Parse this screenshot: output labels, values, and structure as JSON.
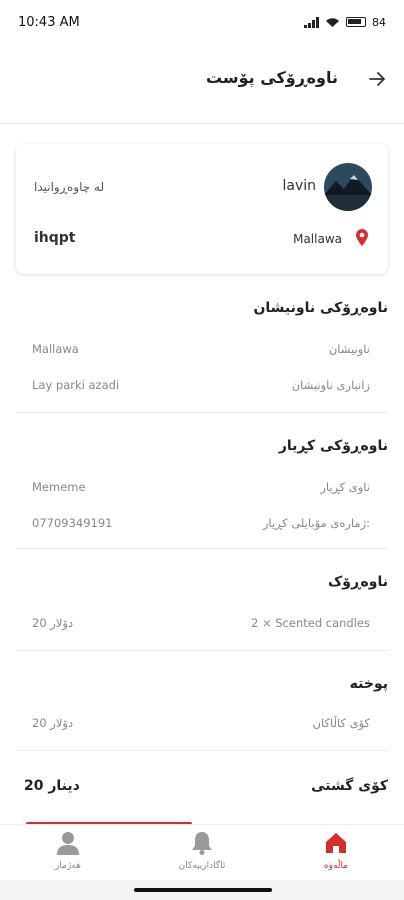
{
  "status": {
    "time": "10:43 AM",
    "battery": "84"
  },
  "header": {
    "title": "ناوەڕۆکی پۆست"
  },
  "order_card": {
    "name": "lavin",
    "waiting_label": "لە چاوەڕوانیدا",
    "order_code": "ihqpt",
    "location": "Mallawa"
  },
  "address_section": {
    "title": "ناوەڕۆکی ناونیشان",
    "rows": [
      {
        "label": "ناونیشان",
        "value": "Mallawa"
      },
      {
        "label": "زانیاری ناونیشان",
        "value": "Lay parki azadi"
      }
    ]
  },
  "user_section": {
    "title": "ناوەڕۆکی کڕیار",
    "rows": [
      {
        "label": "ناوی کڕیار",
        "value": "Mememe"
      },
      {
        "label": "ژمارەی مۆبایلی کڕیار:",
        "value": "07709349191"
      }
    ]
  },
  "content_section": {
    "title": "ناوەڕۆک",
    "rows": [
      {
        "label": "2 × Scented candles",
        "value": "20 دۆلار"
      }
    ]
  },
  "fee_section": {
    "title": "پوختە",
    "rows": [
      {
        "label": "کۆی کاڵاکان",
        "value": "20 دۆلار"
      }
    ]
  },
  "total": {
    "label": "کۆی گشتی",
    "value": "20 دینار"
  },
  "bottom_nav": {
    "items": [
      {
        "label": "ماڵەوە",
        "icon": "home-icon",
        "active": true
      },
      {
        "label": "ئاگادارییەکان",
        "icon": "bell-icon",
        "active": false
      },
      {
        "label": "هەژمار",
        "icon": "person-icon",
        "active": false
      }
    ]
  },
  "colors": {
    "accent": "#d32f2f"
  }
}
